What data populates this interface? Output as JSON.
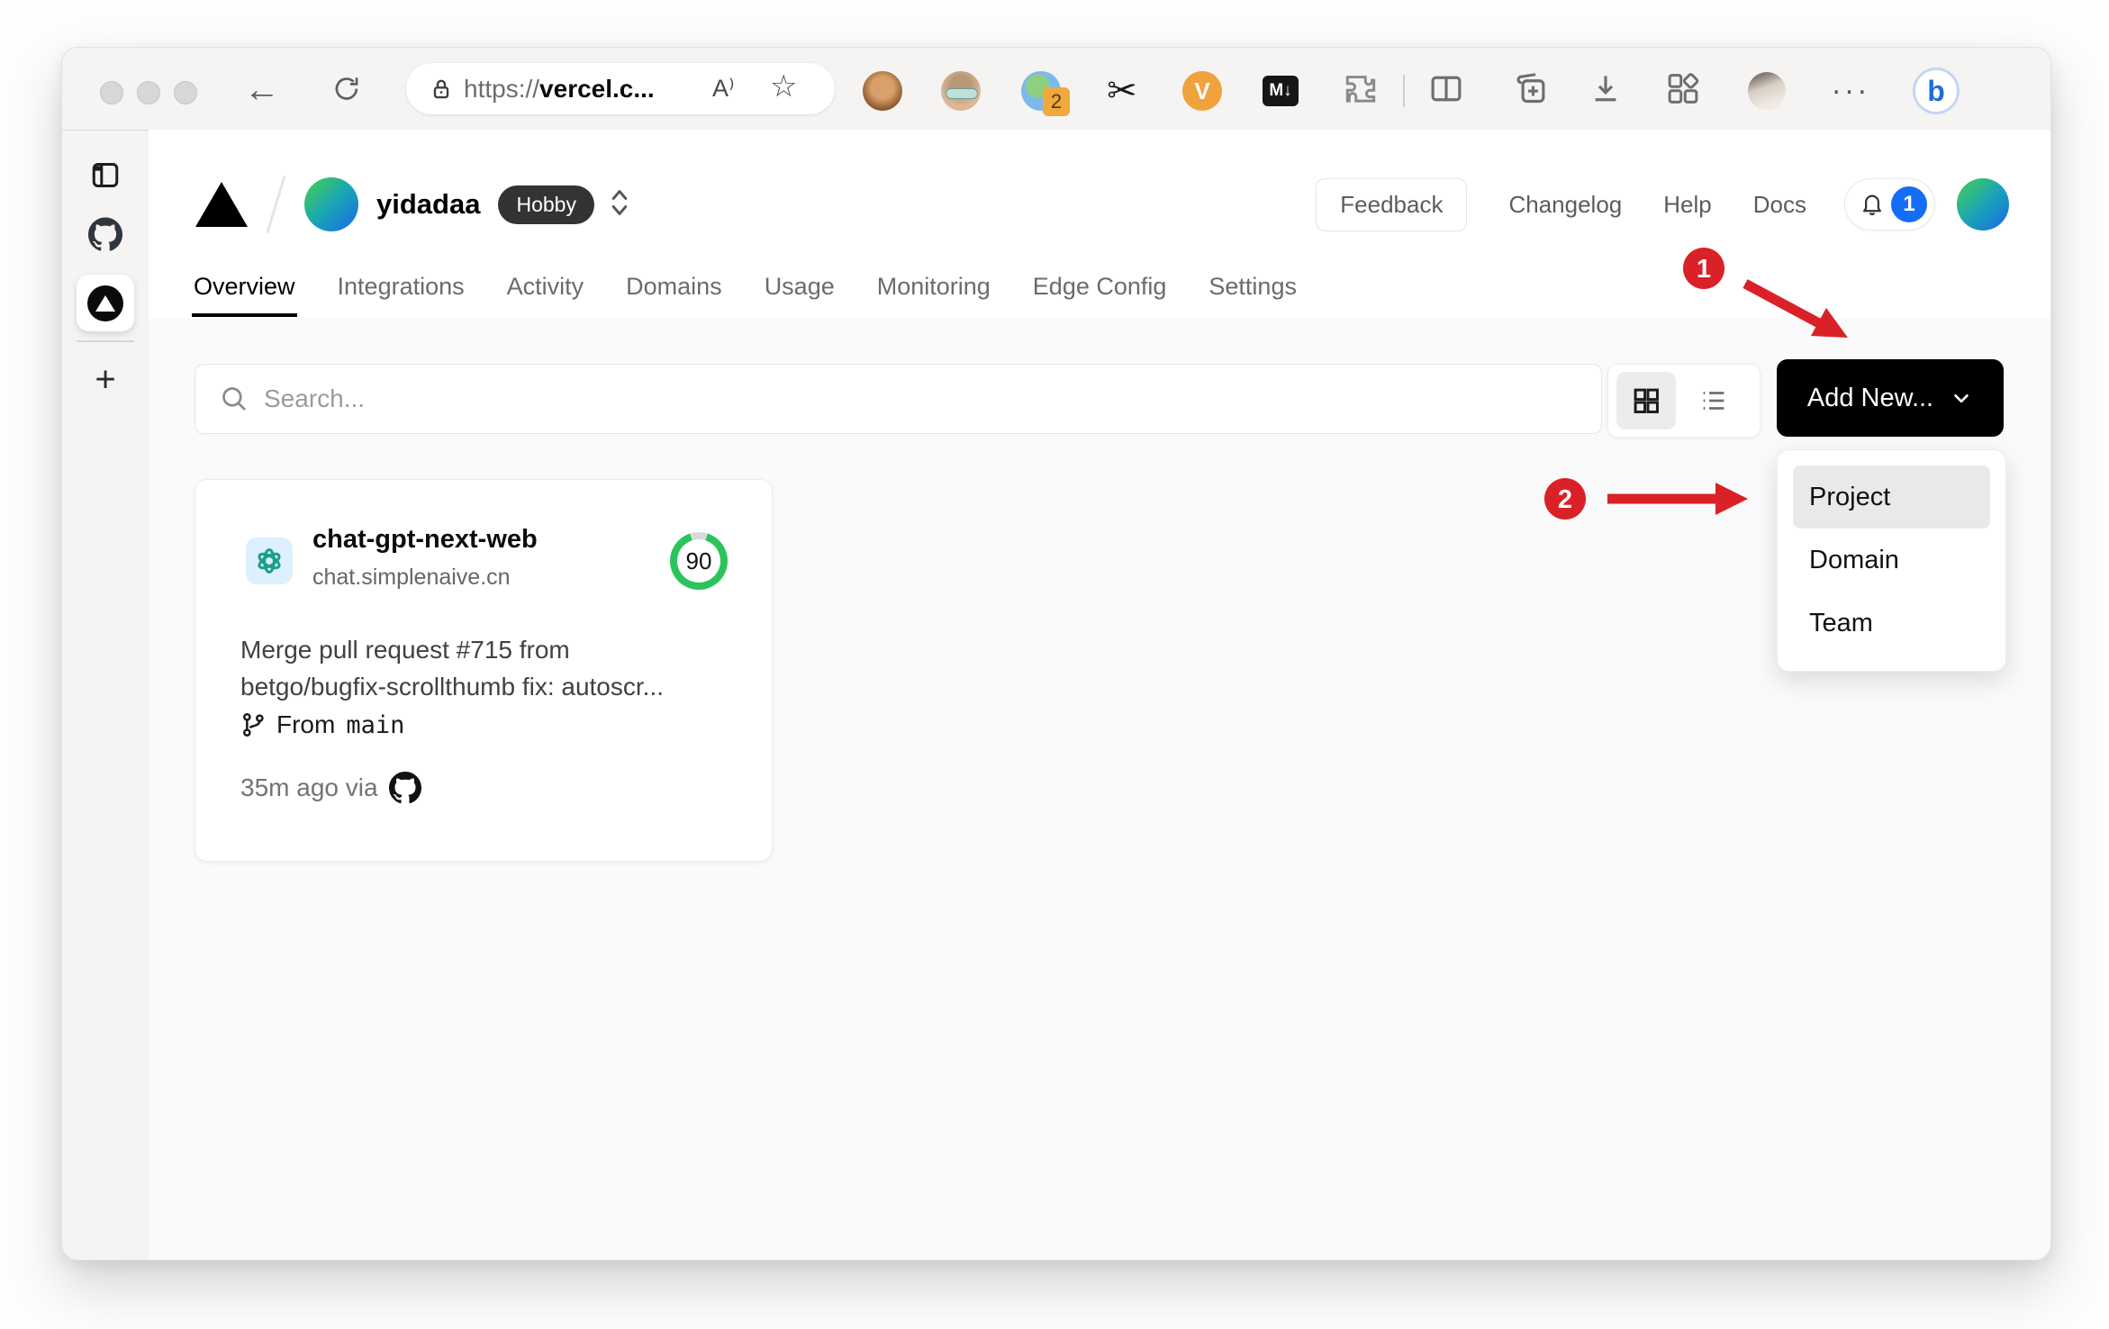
{
  "browser": {
    "back_glyph": "←",
    "url": {
      "prefix": "https://",
      "host_visible": "vercel.c..."
    },
    "reading_view_label": "A⁾",
    "favorites_star": "☆",
    "extensions": {
      "badge_count": "2",
      "scissors_glyph": "✂",
      "video_letter": "V",
      "markdown_label": "M↓",
      "menu_dots": "···",
      "bing_letter": "b"
    },
    "sidebar_plus": "+"
  },
  "header": {
    "team_name": "yidadaa",
    "plan_badge": "Hobby",
    "feedback_label": "Feedback",
    "links": [
      {
        "label": "Changelog"
      },
      {
        "label": "Help"
      },
      {
        "label": "Docs"
      }
    ],
    "notification_count": "1"
  },
  "nav": {
    "tabs": [
      {
        "label": "Overview",
        "active": true
      },
      {
        "label": "Integrations"
      },
      {
        "label": "Activity"
      },
      {
        "label": "Domains"
      },
      {
        "label": "Usage"
      },
      {
        "label": "Monitoring"
      },
      {
        "label": "Edge Config"
      },
      {
        "label": "Settings"
      }
    ]
  },
  "toolbar_row": {
    "search_placeholder": "Search...",
    "add_new_label": "Add New..."
  },
  "dropdown": {
    "items": [
      {
        "label": "Project",
        "highlighted": true
      },
      {
        "label": "Domain"
      },
      {
        "label": "Team"
      }
    ]
  },
  "project_card": {
    "name": "chat-gpt-next-web",
    "domain": "chat.simplenaive.cn",
    "score": "90",
    "commit_line1": "Merge pull request #715 from",
    "commit_line2": "betgo/bugfix-scrollthumb fix: autoscr...",
    "branch_label": "From",
    "branch_name": "main",
    "deploy_meta": "35m ago via"
  },
  "annotations": {
    "step1": "1",
    "step2": "2"
  },
  "colors": {
    "accent_red": "#d92127",
    "badge_blue": "#146ef5",
    "score_green": "#2bc45c",
    "openai_teal": "#1ba08e",
    "add_new_black": "#000000"
  }
}
